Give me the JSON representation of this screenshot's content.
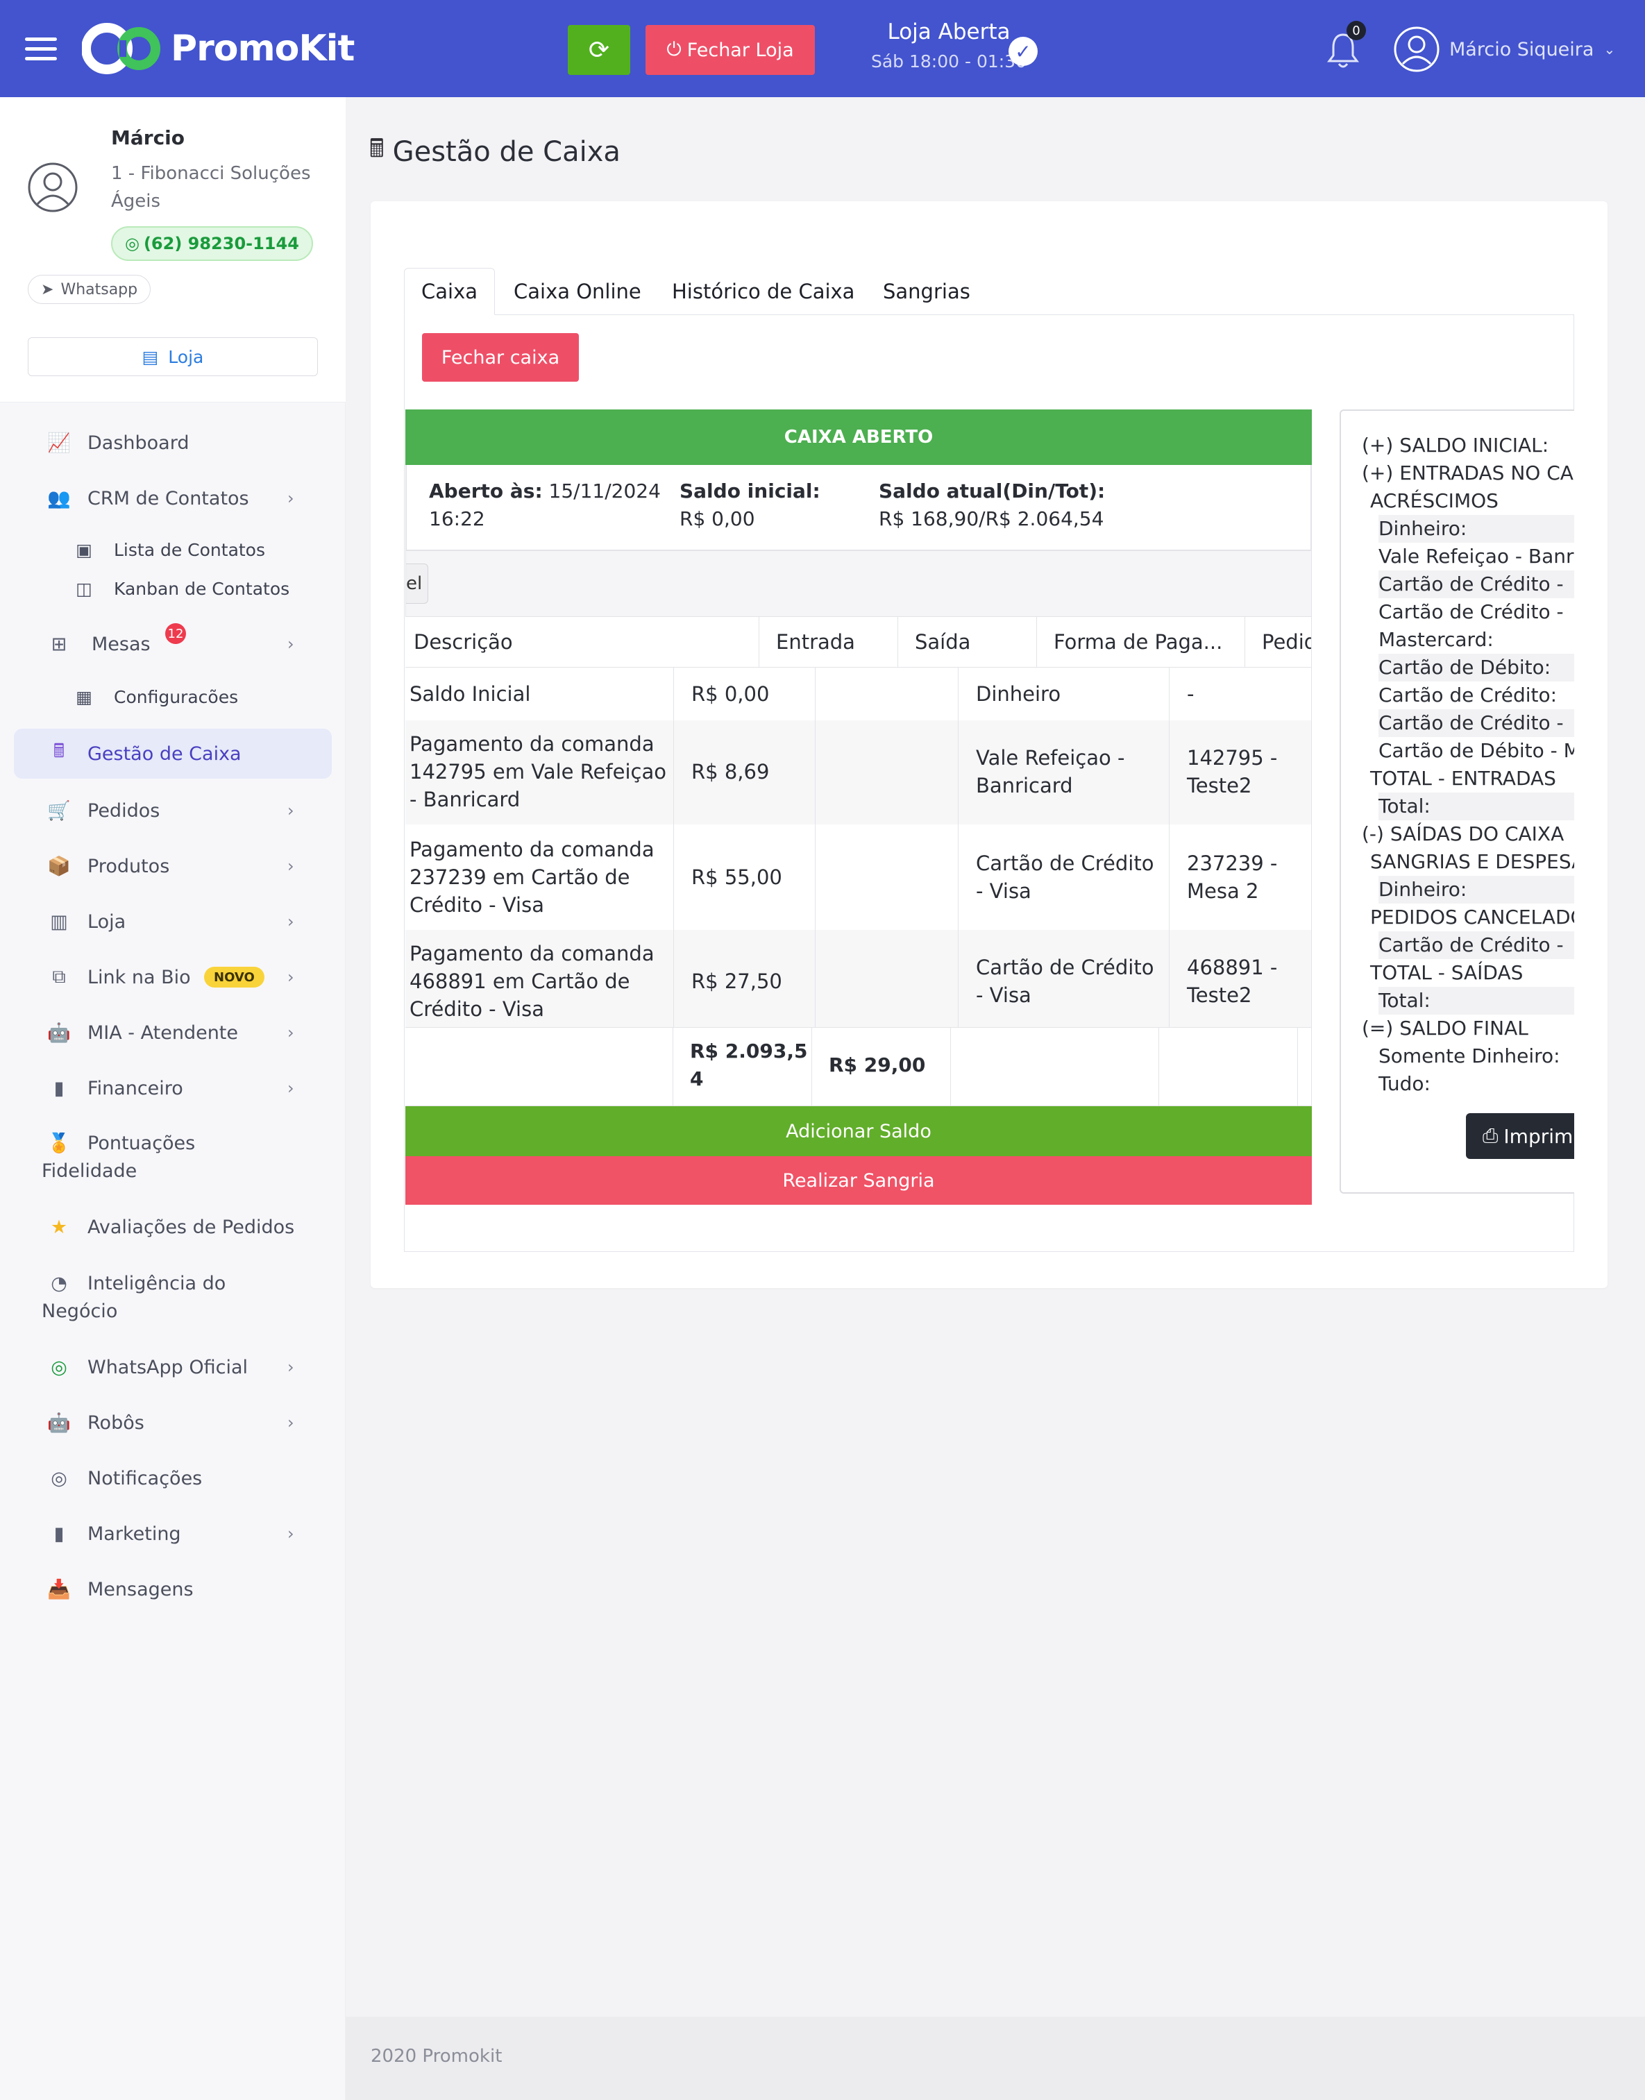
{
  "header": {
    "brand": "PromoKit",
    "fechar_loja_label": "Fechar Loja",
    "loja_status": "Loja Aberta",
    "loja_hours": "Sáb 18:00 - 01:30",
    "notifications_count": "0",
    "user_name": "Márcio Siqueira",
    "colors": {
      "bar": "#4354ce",
      "green": "#52b01e",
      "red": "#ee4f67"
    }
  },
  "sidebar": {
    "profile": {
      "name": "Márcio",
      "company": "1 - Fibonacci Soluções Ágeis",
      "phone": "(62) 98230-1144",
      "whatsapp": "Whatsapp",
      "loja": "Loja"
    },
    "items": [
      {
        "label": "Dashboard",
        "icon": "chart-line-icon"
      },
      {
        "label": "CRM de Contatos",
        "icon": "users-icon"
      },
      {
        "label": "Lista de Contatos",
        "icon": "address-book-icon"
      },
      {
        "label": "Kanban de Contatos",
        "icon": "columns-icon"
      },
      {
        "label": "Mesas",
        "icon": "table-icon",
        "badge": "12"
      },
      {
        "label": "Configuracões",
        "icon": "cubes-icon"
      },
      {
        "label": "Gestão de Caixa",
        "icon": "cash-register-icon"
      },
      {
        "label": "Pedidos",
        "icon": "cart-icon"
      },
      {
        "label": "Produtos",
        "icon": "box-icon"
      },
      {
        "label": "Loja",
        "icon": "building-icon"
      },
      {
        "label": "Link na Bio",
        "icon": "sitemap-icon",
        "badge": "NOVO"
      },
      {
        "label": "MIA - Atendente",
        "icon": "robot-icon"
      },
      {
        "label": "Financeiro",
        "icon": "bar-chart-icon"
      },
      {
        "label": "Pontuações",
        "label2": "Fidelidade",
        "icon": "medal-icon"
      },
      {
        "label": "Avaliações de Pedidos",
        "icon": "star-icon"
      },
      {
        "label": "Inteligência do",
        "label2": "Negócio",
        "icon": "pie-chart-icon"
      },
      {
        "label": "WhatsApp Oficial",
        "icon": "whatsapp-icon"
      },
      {
        "label": "Robôs",
        "icon": "robot-icon"
      },
      {
        "label": "Notificações",
        "icon": "whatsapp-icon"
      },
      {
        "label": "Marketing",
        "icon": "bar-chart-icon"
      },
      {
        "label": "Mensagens",
        "icon": "inbox-icon"
      }
    ]
  },
  "main": {
    "page_title": "Gestão de Caixa",
    "tabs": [
      "Caixa",
      "Caixa Online",
      "Histórico de Caixa",
      "Sangrias"
    ],
    "fechar_caixa": "Fechar caixa",
    "caixa_status": "CAIXA ABERTO",
    "aberto_label": "Aberto às:",
    "aberto_value": "15/11/2024",
    "aberto_time": "16:22",
    "saldo_inicial_label": "Saldo inicial:",
    "saldo_inicial_value": "R$ 0,00",
    "saldo_atual_label": "Saldo atual(Din/Tot):",
    "saldo_atual_value": "R$ 168,90/R$ 2.064,54",
    "strip_button": "el",
    "table": {
      "headers": [
        "Descrição",
        "Entrada",
        "Saída",
        "Forma de Paga...",
        "Pedido/C..."
      ],
      "rows": [
        {
          "desc": [
            "Saldo Inicial"
          ],
          "entrada": "R$ 0,00",
          "saida": "",
          "forma": [
            "Dinheiro"
          ],
          "pedido": [
            "-"
          ]
        },
        {
          "desc": [
            "Pagamento da comanda",
            "142795 em Vale Refeiçao",
            "- Banricard"
          ],
          "entrada": "R$ 8,69",
          "saida": "",
          "forma": [
            "Vale Refeiçao -",
            "Banricard"
          ],
          "pedido": [
            "142795 -",
            "Teste2"
          ]
        },
        {
          "desc": [
            "Pagamento da comanda",
            "237239 em Cartão de",
            "Crédito - Visa"
          ],
          "entrada": "R$ 55,00",
          "saida": "",
          "forma": [
            "Cartão de Crédito",
            "- Visa"
          ],
          "pedido": [
            "237239 -",
            "Mesa 2"
          ]
        },
        {
          "desc": [
            "Pagamento da comanda",
            "468891 em Cartão de",
            "Crédito - Visa"
          ],
          "entrada": "R$ 27,50",
          "saida": "",
          "forma": [
            "Cartão de Crédito",
            "- Visa"
          ],
          "pedido": [
            "468891 -",
            "Teste2"
          ]
        }
      ],
      "total_entrada": [
        "R$ 2.093,5",
        "4"
      ],
      "total_saida": "R$ 29,00"
    },
    "adicionar_saldo": "Adicionar Saldo",
    "realizar_sangria": "Realizar Sangria",
    "resumo": [
      "(+) SALDO INICIAL:",
      "(+) ENTRADAS NO CAIX",
      "ACRÉSCIMOS",
      "Dinheiro:",
      "Vale Refeiçao - Banr",
      "Cartão de Crédito -",
      "Cartão de Crédito -",
      "Mastercard:",
      "Cartão de Débito:",
      "Cartão de Crédito:",
      "Cartão de Crédito -",
      "Cartão de Débito - M",
      "TOTAL - ENTRADAS",
      "Total:",
      "(-) SAÍDAS DO CAIXA",
      "SANGRIAS E DESPESAS",
      "Dinheiro:",
      "PEDIDOS CANCELADO",
      "Cartão de Crédito -",
      "TOTAL - SAÍDAS",
      "Total:",
      "(=) SALDO FINAL",
      "Somente Dinheiro:",
      "Tudo:"
    ],
    "imprimir": "Imprim"
  },
  "footer": {
    "text": "2020 Promokit"
  }
}
